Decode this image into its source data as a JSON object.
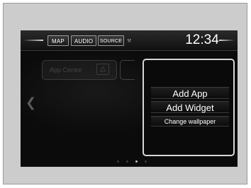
{
  "topbar": {
    "map_label": "MAP",
    "audio_label": "AUDIO",
    "source_label": "SOURCE",
    "tools_icon": "wrench-icon",
    "clock": "12:34"
  },
  "home": {
    "app_tile_label": "App Centre",
    "app_tile_icon": "app-centre-icon",
    "left_arrow_icon": "chevron-left-icon"
  },
  "menu": {
    "items": [
      {
        "label": "Add App"
      },
      {
        "label": "Add Widget"
      },
      {
        "label": "Change wallpaper"
      }
    ]
  },
  "pager": {
    "page_count": 4,
    "active_page": 3
  },
  "colors": {
    "screen_bg": "#0b0b0b",
    "frame_bg": "#cccccc",
    "text": "#ffffff",
    "panel_border": "#d6d6d6"
  }
}
